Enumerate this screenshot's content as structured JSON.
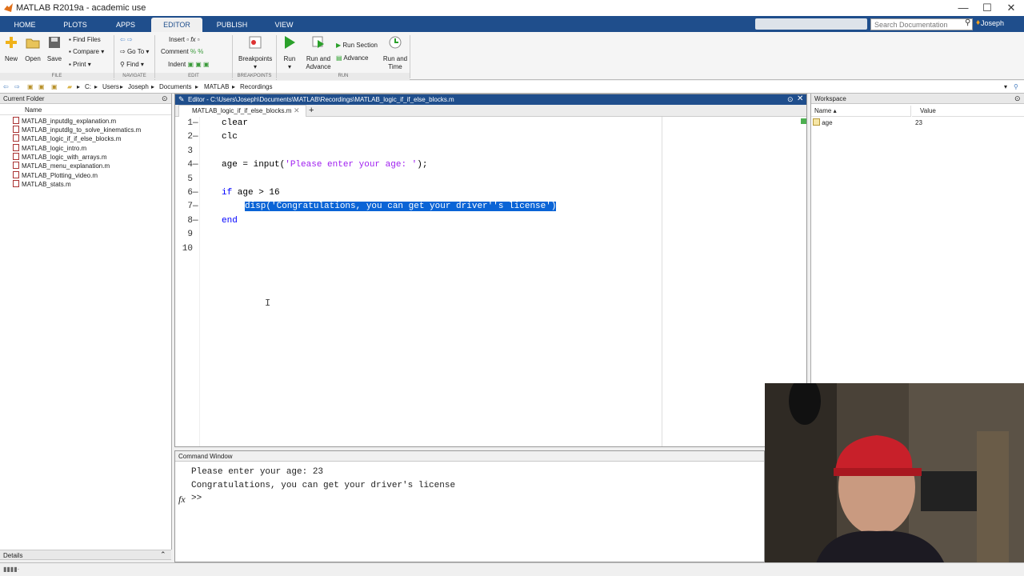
{
  "window": {
    "title": "MATLAB R2019a - academic use",
    "min": "—",
    "max": "☐",
    "close": "✕"
  },
  "tabs": [
    "HOME",
    "PLOTS",
    "APPS",
    "EDITOR",
    "PUBLISH",
    "VIEW"
  ],
  "search": {
    "placeholder": "Search Documentation"
  },
  "user": "Joseph",
  "ribbon": {
    "file": {
      "new": "New",
      "open": "Open",
      "save": "Save",
      "find_files": "Find Files",
      "compare": "Compare",
      "print": "Print",
      "section": "FILE"
    },
    "navigate": {
      "go_to": "Go To",
      "find": "Find",
      "section": "NAVIGATE"
    },
    "edit": {
      "insert": "Insert",
      "comment": "Comment",
      "indent": "Indent",
      "section": "EDIT"
    },
    "breakpoints": {
      "label": "Breakpoints",
      "section": "BREAKPOINTS"
    },
    "run": {
      "run": "Run",
      "run_advance_1": "Run and",
      "run_advance_2": "Advance",
      "run_section": "Run Section",
      "advance": "Advance",
      "run_time_1": "Run and",
      "run_time_2": "Time",
      "section": "RUN"
    }
  },
  "address": {
    "parts": [
      "C:",
      "Users",
      "Joseph",
      "Documents",
      "MATLAB",
      "Recordings"
    ]
  },
  "current_folder": {
    "title": "Current Folder",
    "col": "Name",
    "files": [
      "MATLAB_inputdlg_explanation.m",
      "MATLAB_inputdlg_to_solve_kinematics.m",
      "MATLAB_logic_if_if_else_blocks.m",
      "MATLAB_logic_intro.m",
      "MATLAB_logic_with_arrays.m",
      "MATLAB_menu_explanation.m",
      "MATLAB_Plotting_video.m",
      "MATLAB_stats.m"
    ],
    "details": "Details"
  },
  "editor": {
    "title": "Editor - C:\\Users\\Joseph\\Documents\\MATLAB\\Recordings\\MATLAB_logic_if_if_else_blocks.m",
    "tab": "MATLAB_logic_if_if_else_blocks.m",
    "line_numbers": [
      "1",
      "2",
      "3",
      "4",
      "5",
      "6",
      "7",
      "8",
      "9",
      "10"
    ],
    "dash": "—"
  },
  "code": {
    "l1": "clear",
    "l2": "clc",
    "l4a": "age = input(",
    "l4s": "'Please enter your age: '",
    "l4b": ");",
    "l6k": "if",
    "l6r": " age > 16",
    "l7": "disp('Congratulations, you can get your driver''s license')",
    "l8": "end"
  },
  "workspace": {
    "title": "Workspace",
    "col_name": "Name",
    "col_value": "Value",
    "var_name": "age",
    "var_value": "23"
  },
  "command": {
    "title": "Command Window",
    "lines": "Please enter your age: 23\nCongratulations, you can get your driver's license",
    "prompt": ">>",
    "fx": "fx"
  },
  "colors": {
    "accent": "#1f4e8c",
    "selection": "#0a64d6",
    "keyword": "#0000ff",
    "string": "#a020f0"
  }
}
